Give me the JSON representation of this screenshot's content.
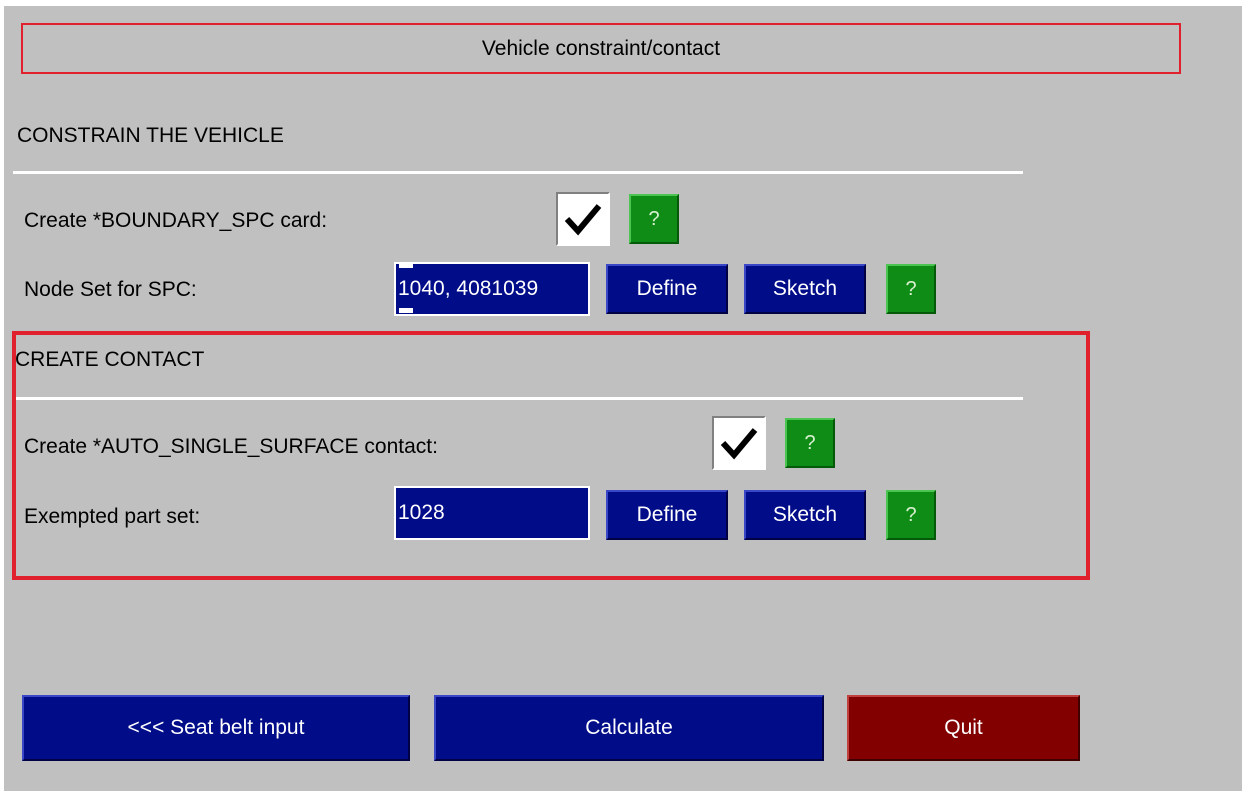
{
  "window": {
    "title": "Vehicle constraint/contact"
  },
  "constrain_section": {
    "heading": "CONSTRAIN THE VEHICLE",
    "boundary_spc": {
      "label": "Create *BOUNDARY_SPC card:",
      "checked": true,
      "help_label": "?"
    },
    "node_set": {
      "label": "Node Set for SPC:",
      "value": "1040, 4081039",
      "define_label": "Define",
      "sketch_label": "Sketch",
      "help_label": "?"
    }
  },
  "contact_section": {
    "heading": "CREATE CONTACT",
    "auto_single_surface": {
      "label": "Create *AUTO_SINGLE_SURFACE contact:",
      "checked": true,
      "help_label": "?"
    },
    "exempted_part_set": {
      "label": "Exempted part set:",
      "value": "1028",
      "define_label": "Define",
      "sketch_label": "Sketch",
      "help_label": "?"
    }
  },
  "footer": {
    "back_label": "<<< Seat belt input",
    "calculate_label": "Calculate",
    "quit_label": "Quit"
  },
  "colors": {
    "panel_bg": "#c0c0c0",
    "button_blue": "#000c88",
    "help_green": "#0e8c16",
    "quit_red": "#820000",
    "highlight_red": "#e0202c"
  },
  "icons": {
    "checkbox_mark": "checkmark-icon"
  }
}
